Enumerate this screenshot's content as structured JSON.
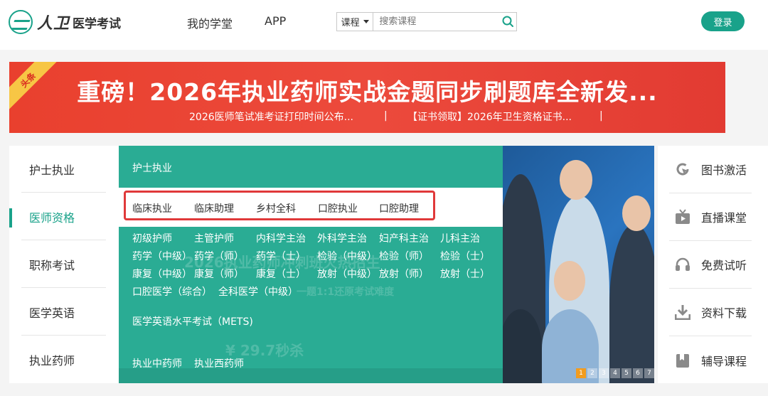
{
  "header": {
    "logo_brand": "人卫",
    "logo_title": "医学考试",
    "nav": [
      "我的学堂",
      "APP"
    ],
    "search": {
      "category": "课程",
      "placeholder": "搜索课程"
    },
    "login": "登录"
  },
  "banner": {
    "ribbon": "头条",
    "headline": "重磅！2026年执业药师实战金题同步刷题库全新发...",
    "subs": [
      "2026医师笔试准考证打印时间公布...",
      "【证书领取】2026年卫生资格证书..."
    ],
    "separator": "|",
    "colors": {
      "background": "#e9402e",
      "ribbon": "#f7c645"
    }
  },
  "left_menu": {
    "items": [
      "护士执业",
      "医师资格",
      "职称考试",
      "医学英语",
      "执业药师"
    ],
    "active_index": 1
  },
  "dropdown": {
    "heading": "护士执业",
    "highlighted": [
      "临床执业",
      "临床助理",
      "乡村全科",
      "口腔执业",
      "口腔助理"
    ],
    "rows": [
      [
        "初级护师",
        "主管护师",
        "内科学主治",
        "外科学主治",
        "妇产科主治",
        "儿科主治"
      ],
      [
        "药学（中级）",
        "药学（师）",
        "药学（士）",
        "检验（中级）",
        "检验（师）",
        "检验（士）"
      ],
      [
        "康复（中级）",
        "康复（师）",
        "康复（士）",
        "放射（中级）",
        "放射（师）",
        "放射（士）"
      ],
      [
        "口腔医学（综合）",
        "全科医学（中级）"
      ]
    ],
    "mets": "医学英语水平考试（METS)",
    "pharma": [
      "执业中药师",
      "执业西药师"
    ],
    "background_text": [
      "2026执业药师冲刺班火热招生",
      "一题1:1还原考试难度",
      "¥ 29.7秒杀"
    ],
    "colors": {
      "overlay": "#1aa68c",
      "highlight_border": "#e0393a"
    }
  },
  "photo": {
    "pager": [
      "1",
      "2",
      "3",
      "4",
      "5",
      "6",
      "7"
    ],
    "active_page": 0
  },
  "right_menu": {
    "items": [
      {
        "label": "图书激活",
        "icon": "book-activate-icon"
      },
      {
        "label": "直播课堂",
        "icon": "live-class-icon"
      },
      {
        "label": "免费试听",
        "icon": "headphones-icon"
      },
      {
        "label": "资料下载",
        "icon": "download-icon"
      },
      {
        "label": "辅导课程",
        "icon": "course-book-icon"
      }
    ]
  },
  "accent_color": "#19a28a"
}
